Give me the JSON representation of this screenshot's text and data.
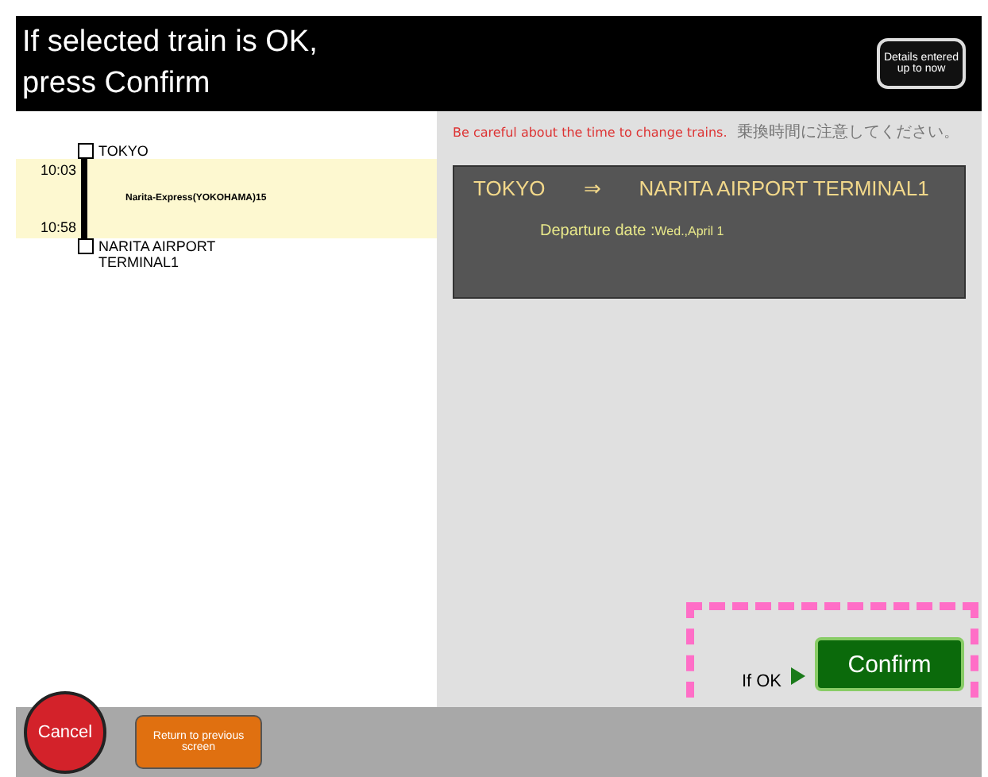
{
  "header": {
    "title": "If selected train is OK,\npress Confirm",
    "details_button": "Details entered up to now"
  },
  "route": {
    "departure": {
      "station": "TOKYO",
      "time": "10:03"
    },
    "train": "Narita-Express(YOKOHAMA)15",
    "arrival": {
      "station": "NARITA AIRPORT\nTERMINAL1",
      "time": "10:58"
    }
  },
  "notice": {
    "english": "Be careful about the time to change trains.",
    "japanese": "乗換時間に注意してください。"
  },
  "summary": {
    "from": "TOKYO",
    "arrow": "⇒",
    "to": "NARITA AIRPORT TERMINAL1",
    "date_label": "Departure date :",
    "date": "Wed.,April 1"
  },
  "confirm": {
    "hint": "If OK",
    "button": "Confirm",
    "highlighted": true
  },
  "footer": {
    "cancel": "Cancel",
    "back": "Return to previous screen"
  }
}
